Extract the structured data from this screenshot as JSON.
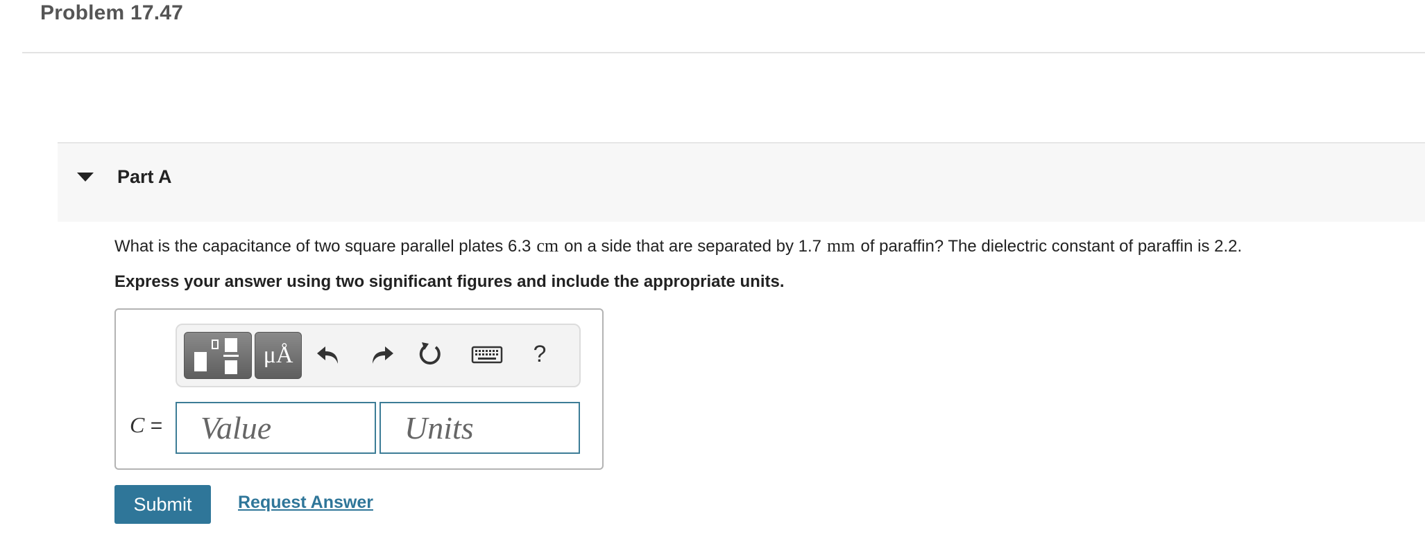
{
  "problem": {
    "title": "Problem 17.47"
  },
  "part": {
    "label": "Part A"
  },
  "question": {
    "text_1": "What is the capacitance of two square parallel plates 6.3",
    "unit_1": "cm",
    "text_2": "on a side that are separated by 1.7",
    "unit_2": "mm",
    "text_3": "of paraffin? The dielectric constant of paraffin is 2.2.",
    "instruction": "Express your answer using two significant figures and include the appropriate units."
  },
  "toolbar": {
    "units_label": "μÅ",
    "help_label": "?",
    "icons": [
      "templates-icon",
      "units-icon",
      "undo-icon",
      "redo-icon",
      "reset-icon",
      "keyboard-icon",
      "help-icon"
    ]
  },
  "answer": {
    "variable": "C",
    "equals": "=",
    "value_placeholder": "Value",
    "units_placeholder": "Units"
  },
  "actions": {
    "submit_label": "Submit",
    "request_label": "Request Answer"
  },
  "colors": {
    "accent": "#2f7699",
    "input_border": "#3c7c96",
    "toolbar_button": "#6f6f6f",
    "header_bg": "#f7f7f7"
  }
}
